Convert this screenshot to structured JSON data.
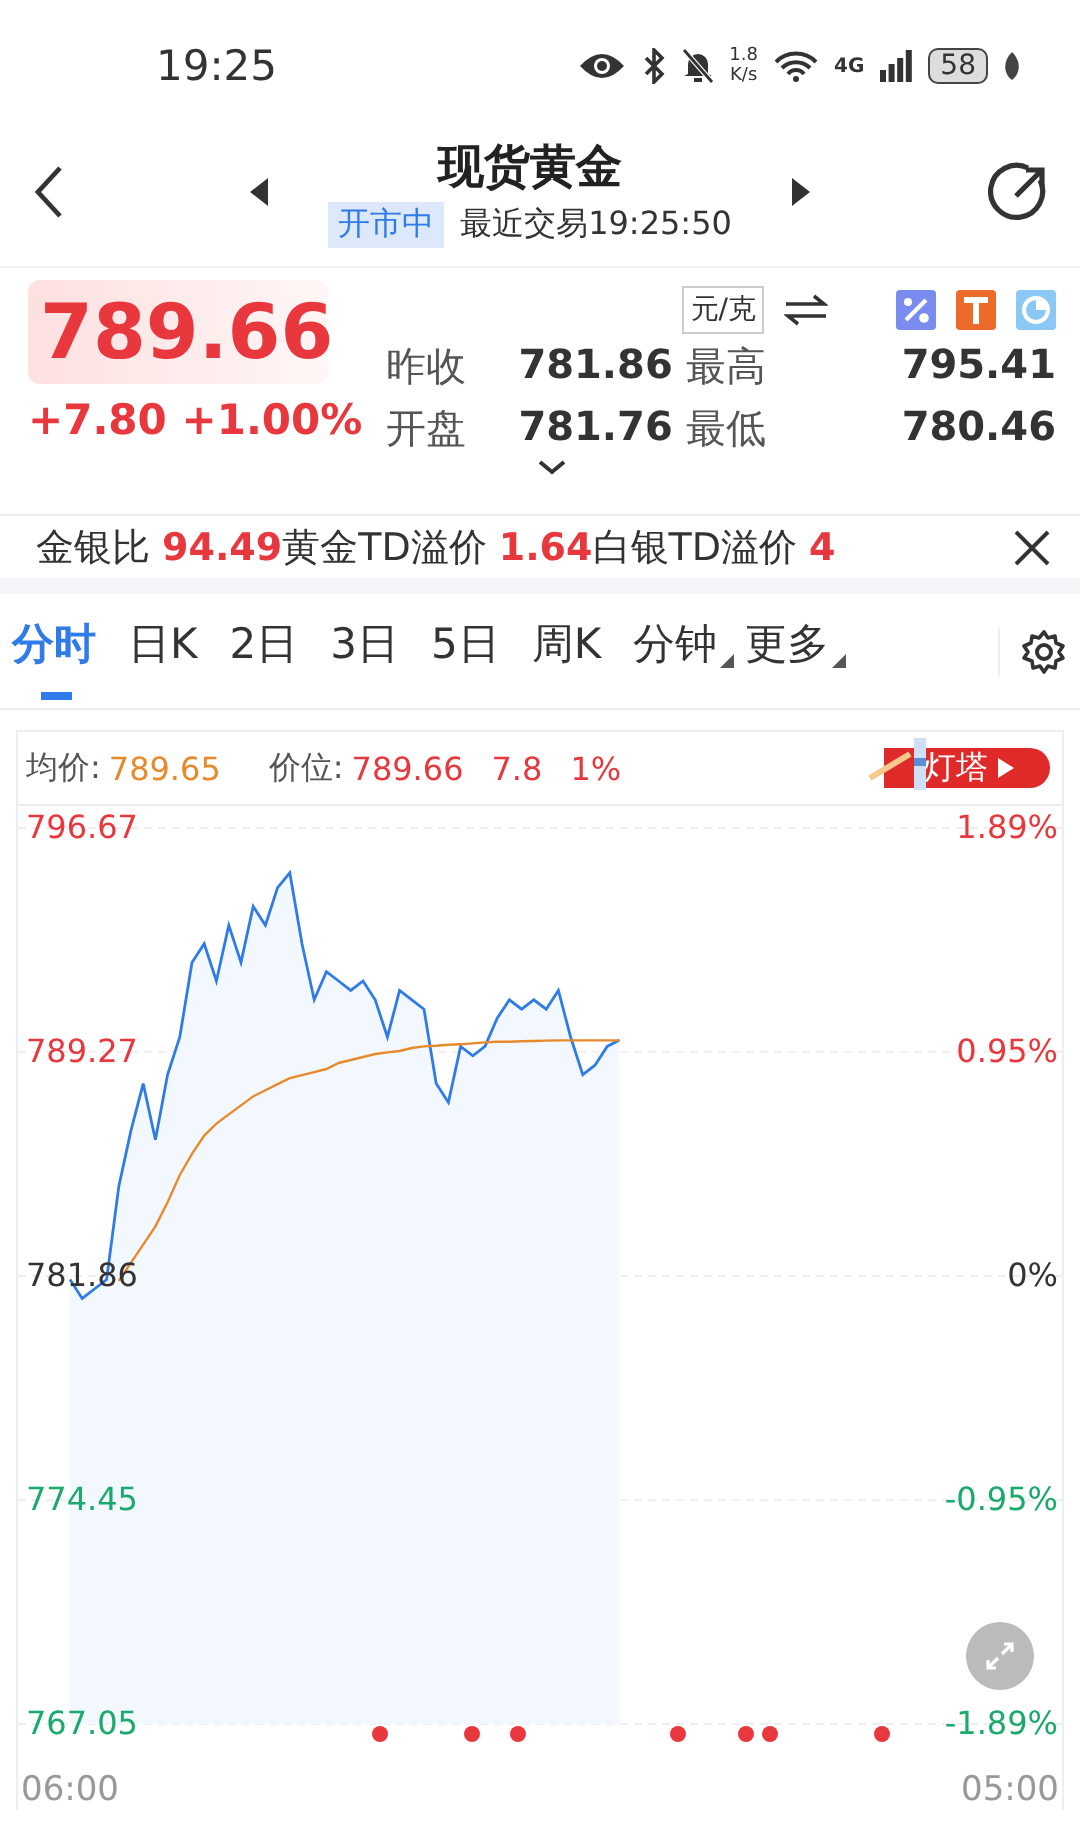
{
  "status_bar": {
    "time": "19:25",
    "speed_value": "1.8",
    "speed_unit": "K/s",
    "network": "4G",
    "battery": "58"
  },
  "header": {
    "title": "现货黄金",
    "market_state": "开市中",
    "last_trade": "最近交易19:25:50"
  },
  "quote": {
    "price": "789.66",
    "change": "+7.80",
    "change_pct": "+1.00%",
    "unit": "元/克",
    "stats": [
      {
        "label": "昨收",
        "value": "781.86"
      },
      {
        "label": "最高",
        "value": "795.41"
      },
      {
        "label": "开盘",
        "value": "781.76"
      },
      {
        "label": "最低",
        "value": "780.46"
      }
    ]
  },
  "ticker": {
    "items": [
      {
        "label": "金银比",
        "value": "94.49"
      },
      {
        "label": "黄金TD溢价",
        "value": "1.64"
      },
      {
        "label": "白银TD溢价",
        "value": "4"
      }
    ]
  },
  "tabs": [
    {
      "label": "分时",
      "selected": true,
      "has_menu": false
    },
    {
      "label": "日K",
      "selected": false,
      "has_menu": false
    },
    {
      "label": "2日",
      "selected": false,
      "has_menu": false
    },
    {
      "label": "3日",
      "selected": false,
      "has_menu": false
    },
    {
      "label": "5日",
      "selected": false,
      "has_menu": false
    },
    {
      "label": "周K",
      "selected": false,
      "has_menu": false
    },
    {
      "label": "分钟",
      "selected": false,
      "has_menu": true
    },
    {
      "label": "更多",
      "selected": false,
      "has_menu": true
    }
  ],
  "chart_info": {
    "avg_label": "均价:",
    "avg_value": "789.65",
    "price_label": "价位:",
    "price_value": "789.66",
    "change": "7.8",
    "change_pct": "1%",
    "badge": "灯塔"
  },
  "chart": {
    "chart_data": {
      "type": "line",
      "grid": true,
      "categories": [
        "06:00",
        null,
        null,
        null,
        null,
        null,
        null,
        null,
        null,
        null,
        null,
        null,
        null,
        null,
        null,
        null,
        null,
        null,
        null,
        null,
        null,
        null,
        null,
        null,
        null,
        null,
        null,
        null,
        null,
        null,
        null,
        null,
        null,
        null,
        null,
        null,
        null,
        null,
        null,
        null,
        null,
        null,
        null,
        null,
        null,
        null,
        null,
        null,
        null,
        null,
        null,
        null,
        null,
        null,
        null,
        null,
        null,
        null,
        null,
        null,
        null,
        null,
        null,
        null,
        null,
        null,
        null,
        null,
        null,
        null,
        null,
        null,
        null,
        null,
        null,
        null,
        null,
        "05:00"
      ],
      "ylim": [
        767.05,
        796.67
      ],
      "yticks": [
        {
          "value": 796.67,
          "label": "796.67"
        },
        {
          "value": 789.27,
          "label": "789.27"
        },
        {
          "value": 781.86,
          "label": "781.86"
        },
        {
          "value": 774.45,
          "label": "774.45"
        },
        {
          "value": 767.05,
          "label": "767.05"
        }
      ],
      "series": [
        {
          "color": "#2f7be8",
          "values": [
            781.74,
            781.12,
            781.43,
            781.74,
            784.82,
            786.67,
            788.22,
            786.36,
            788.52,
            789.76,
            792.23,
            792.84,
            791.61,
            793.46,
            792.23,
            794.08,
            793.46,
            794.7,
            795.19,
            792.84,
            790.99,
            791.92,
            791.61,
            791.3,
            791.61,
            790.99,
            789.76,
            791.3,
            790.99,
            790.68,
            788.22,
            787.6,
            789.45,
            789.14,
            789.45,
            790.38,
            790.99,
            790.68,
            790.99,
            790.68,
            791.3,
            789.76,
            788.52,
            788.83,
            789.45,
            789.66,
            null,
            null,
            null,
            null,
            null,
            null,
            null,
            null,
            null,
            null,
            null,
            null,
            null,
            null,
            null,
            null,
            null,
            null,
            null,
            null,
            null,
            null,
            null,
            null,
            null,
            null,
            null,
            null,
            null,
            null,
            null,
            null
          ]
        },
        {
          "color": "#e8892b",
          "values": [
            null,
            null,
            null,
            null,
            781.7,
            782.3,
            782.9,
            783.5,
            784.3,
            785.2,
            785.9,
            786.5,
            786.9,
            787.2,
            787.5,
            787.8,
            788.0,
            788.2,
            788.4,
            788.5,
            788.6,
            788.7,
            788.9,
            789.0,
            789.1,
            789.2,
            789.25,
            789.3,
            789.4,
            789.45,
            789.47,
            789.5,
            789.52,
            789.55,
            789.58,
            789.6,
            789.6,
            789.62,
            789.63,
            789.64,
            789.65,
            789.65,
            789.65,
            789.65,
            789.65,
            789.65,
            null,
            null,
            null,
            null,
            null,
            null,
            null,
            null,
            null,
            null,
            null,
            null,
            null,
            null,
            null,
            null,
            null,
            null,
            null,
            null,
            null,
            null,
            null,
            null,
            null,
            null,
            null,
            null,
            null,
            null,
            null,
            null
          ]
        }
      ]
    },
    "right_axis": [
      {
        "text": "1.89%",
        "color": "#e8383d"
      },
      {
        "text": "0.95%",
        "color": "#e8383d"
      },
      {
        "text": "0%",
        "color": "#333333"
      },
      {
        "text": "-0.95%",
        "color": "#1aaa6b"
      },
      {
        "text": "-1.89%",
        "color": "#1aaa6b"
      }
    ]
  }
}
